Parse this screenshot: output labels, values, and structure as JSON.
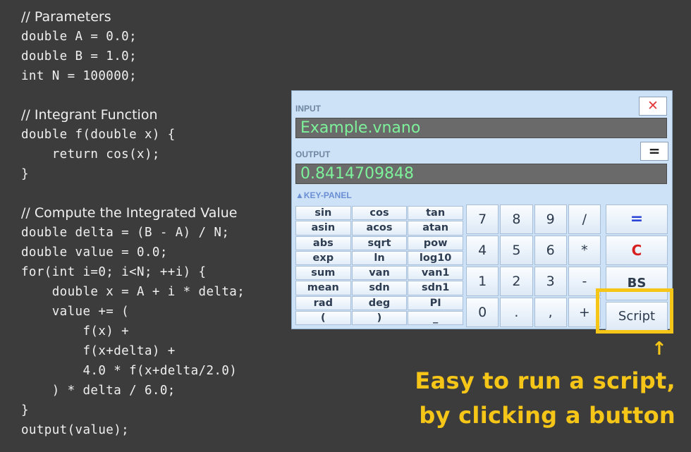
{
  "code": {
    "lines": [
      {
        "text": "// Parameters",
        "kind": "comment"
      },
      {
        "text": "double A = 0.0;",
        "kind": "code"
      },
      {
        "text": "double B = 1.0;",
        "kind": "code"
      },
      {
        "text": "int N = 100000;",
        "kind": "code"
      },
      {
        "text": "",
        "kind": "blank"
      },
      {
        "text": "// Integrant Function",
        "kind": "comment"
      },
      {
        "text": "double f(double x) {",
        "kind": "code"
      },
      {
        "text": "    return cos(x);",
        "kind": "code"
      },
      {
        "text": "}",
        "kind": "code"
      },
      {
        "text": "",
        "kind": "blank"
      },
      {
        "text": "// Compute the Integrated Value",
        "kind": "comment"
      },
      {
        "text": "double delta = (B - A) / N;",
        "kind": "code"
      },
      {
        "text": "double value = 0.0;",
        "kind": "code"
      },
      {
        "text": "for(int i=0; i<N; ++i) {",
        "kind": "code"
      },
      {
        "text": "    double x = A + i * delta;",
        "kind": "code"
      },
      {
        "text": "    value += (",
        "kind": "code"
      },
      {
        "text": "        f(x) +",
        "kind": "code"
      },
      {
        "text": "        f(x+delta) +",
        "kind": "code"
      },
      {
        "text": "        4.0 * f(x+delta/2.0)",
        "kind": "code"
      },
      {
        "text": "    ) * delta / 6.0;",
        "kind": "code"
      },
      {
        "text": "}",
        "kind": "code"
      },
      {
        "text": "output(value);",
        "kind": "code"
      }
    ]
  },
  "calculator": {
    "input_label": "INPUT",
    "input_value": "Example.vnano",
    "output_label": "OUTPUT",
    "output_value": "0.8414709848",
    "close_icon": "✕",
    "equals_top": "=",
    "key_panel_label": "▲KEY-PANEL",
    "function_keys": [
      [
        "sin",
        "cos",
        "tan"
      ],
      [
        "asin",
        "acos",
        "atan"
      ],
      [
        "abs",
        "sqrt",
        "pow"
      ],
      [
        "exp",
        "ln",
        "log10"
      ],
      [
        "sum",
        "van",
        "van1"
      ],
      [
        "mean",
        "sdn",
        "sdn1"
      ],
      [
        "rad",
        "deg",
        "PI"
      ],
      [
        "(",
        ")",
        "_"
      ]
    ],
    "number_keys": [
      [
        "7",
        "8",
        "9",
        "/"
      ],
      [
        "4",
        "5",
        "6",
        "*"
      ],
      [
        "1",
        "2",
        "3",
        "-"
      ],
      [
        "0",
        ".",
        ",",
        "+"
      ]
    ],
    "operation_keys": {
      "equals": "=",
      "clear": "C",
      "backspace": "BS",
      "script": "Script"
    }
  },
  "annotation": {
    "arrow": "↑",
    "line1": "Easy to run a script,",
    "line2": "by clicking a button",
    "color": "#f5c518"
  }
}
